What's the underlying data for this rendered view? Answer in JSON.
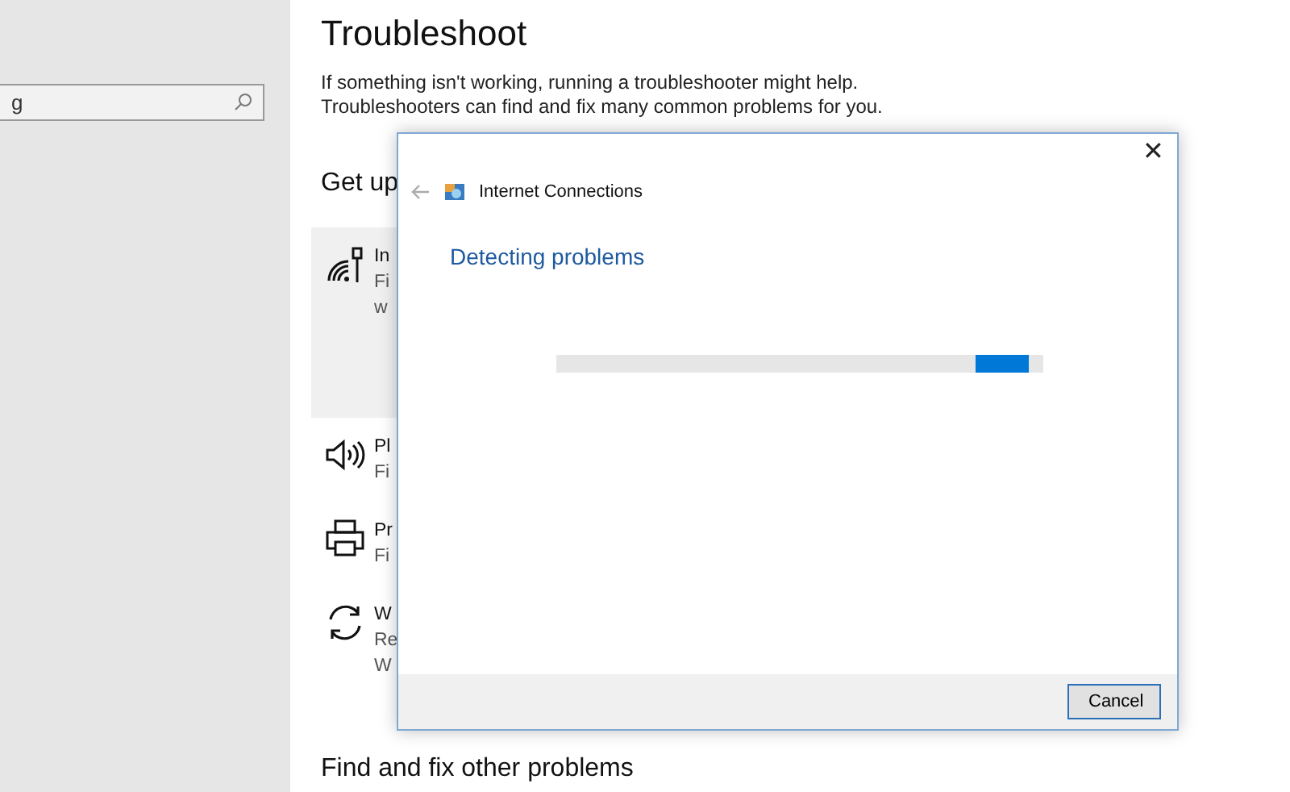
{
  "sidebar": {
    "search": {
      "value": "g"
    }
  },
  "main": {
    "title": "Troubleshoot",
    "description": [
      "If something isn't working, running a troubleshooter might help.",
      "Troubleshooters can find and fix many common problems for you."
    ],
    "section": "Get up",
    "items": [
      {
        "kind": "wifi",
        "selected": true,
        "lines": [
          "In",
          "Fi",
          "w"
        ]
      },
      {
        "kind": "speaker",
        "selected": false,
        "lines": [
          "Pl",
          "Fi"
        ]
      },
      {
        "kind": "printer",
        "selected": false,
        "lines": [
          "Pr",
          "Fi"
        ]
      },
      {
        "kind": "sync",
        "selected": false,
        "lines": [
          "W",
          "Re",
          "W"
        ]
      }
    ],
    "footer_heading": "Find and fix other problems"
  },
  "dialog": {
    "close": "✕",
    "title": "Internet Connections",
    "heading": "Detecting problems",
    "progress": {
      "marquee": true
    },
    "buttons": [
      "Cancel"
    ]
  }
}
